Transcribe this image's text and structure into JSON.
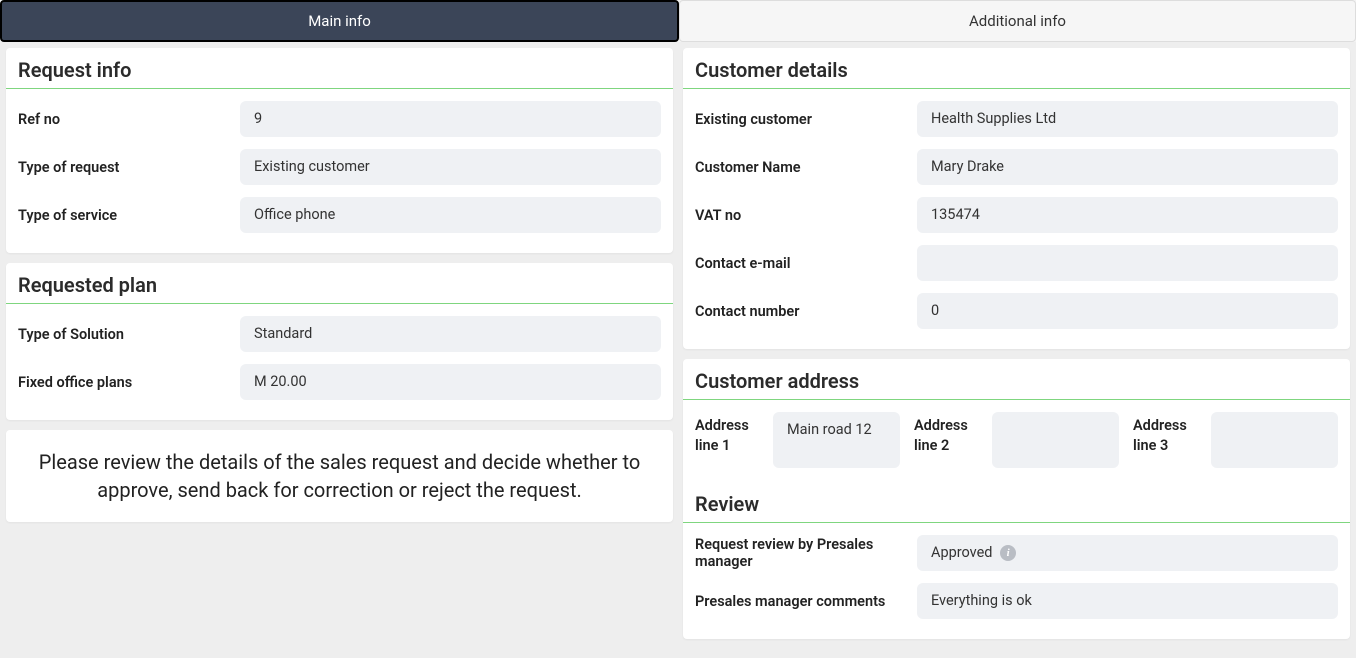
{
  "tabs": {
    "main": "Main info",
    "additional": "Additional info"
  },
  "request_info": {
    "heading": "Request info",
    "ref_no_label": "Ref no",
    "ref_no": "9",
    "type_of_request_label": "Type of request",
    "type_of_request": "Existing customer",
    "type_of_service_label": "Type of service",
    "type_of_service": "Office phone"
  },
  "requested_plan": {
    "heading": "Requested plan",
    "type_of_solution_label": "Type of Solution",
    "type_of_solution": "Standard",
    "fixed_office_plans_label": "Fixed office plans",
    "fixed_office_plans": "M 20.00"
  },
  "instruction": "Please review the details of the sales request and decide whether to approve, send back for correction or reject the request.",
  "customer_details": {
    "heading": "Customer details",
    "existing_customer_label": "Existing customer",
    "existing_customer": "Health Supplies Ltd",
    "customer_name_label": "Customer Name",
    "customer_name": "Mary Drake",
    "vat_no_label": "VAT no",
    "vat_no": "135474",
    "contact_email_label": "Contact e-mail",
    "contact_email": "",
    "contact_number_label": "Contact number",
    "contact_number": "0"
  },
  "customer_address": {
    "heading": "Customer address",
    "line1_label": "Address line 1",
    "line1": "Main road 12",
    "line2_label": "Address line 2",
    "line2": "",
    "line3_label": "Address line 3",
    "line3": ""
  },
  "review": {
    "heading": "Review",
    "presales_review_label": "Request review by Presales manager",
    "presales_review": "Approved",
    "presales_comments_label": "Presales manager comments",
    "presales_comments": "Everything is ok"
  }
}
